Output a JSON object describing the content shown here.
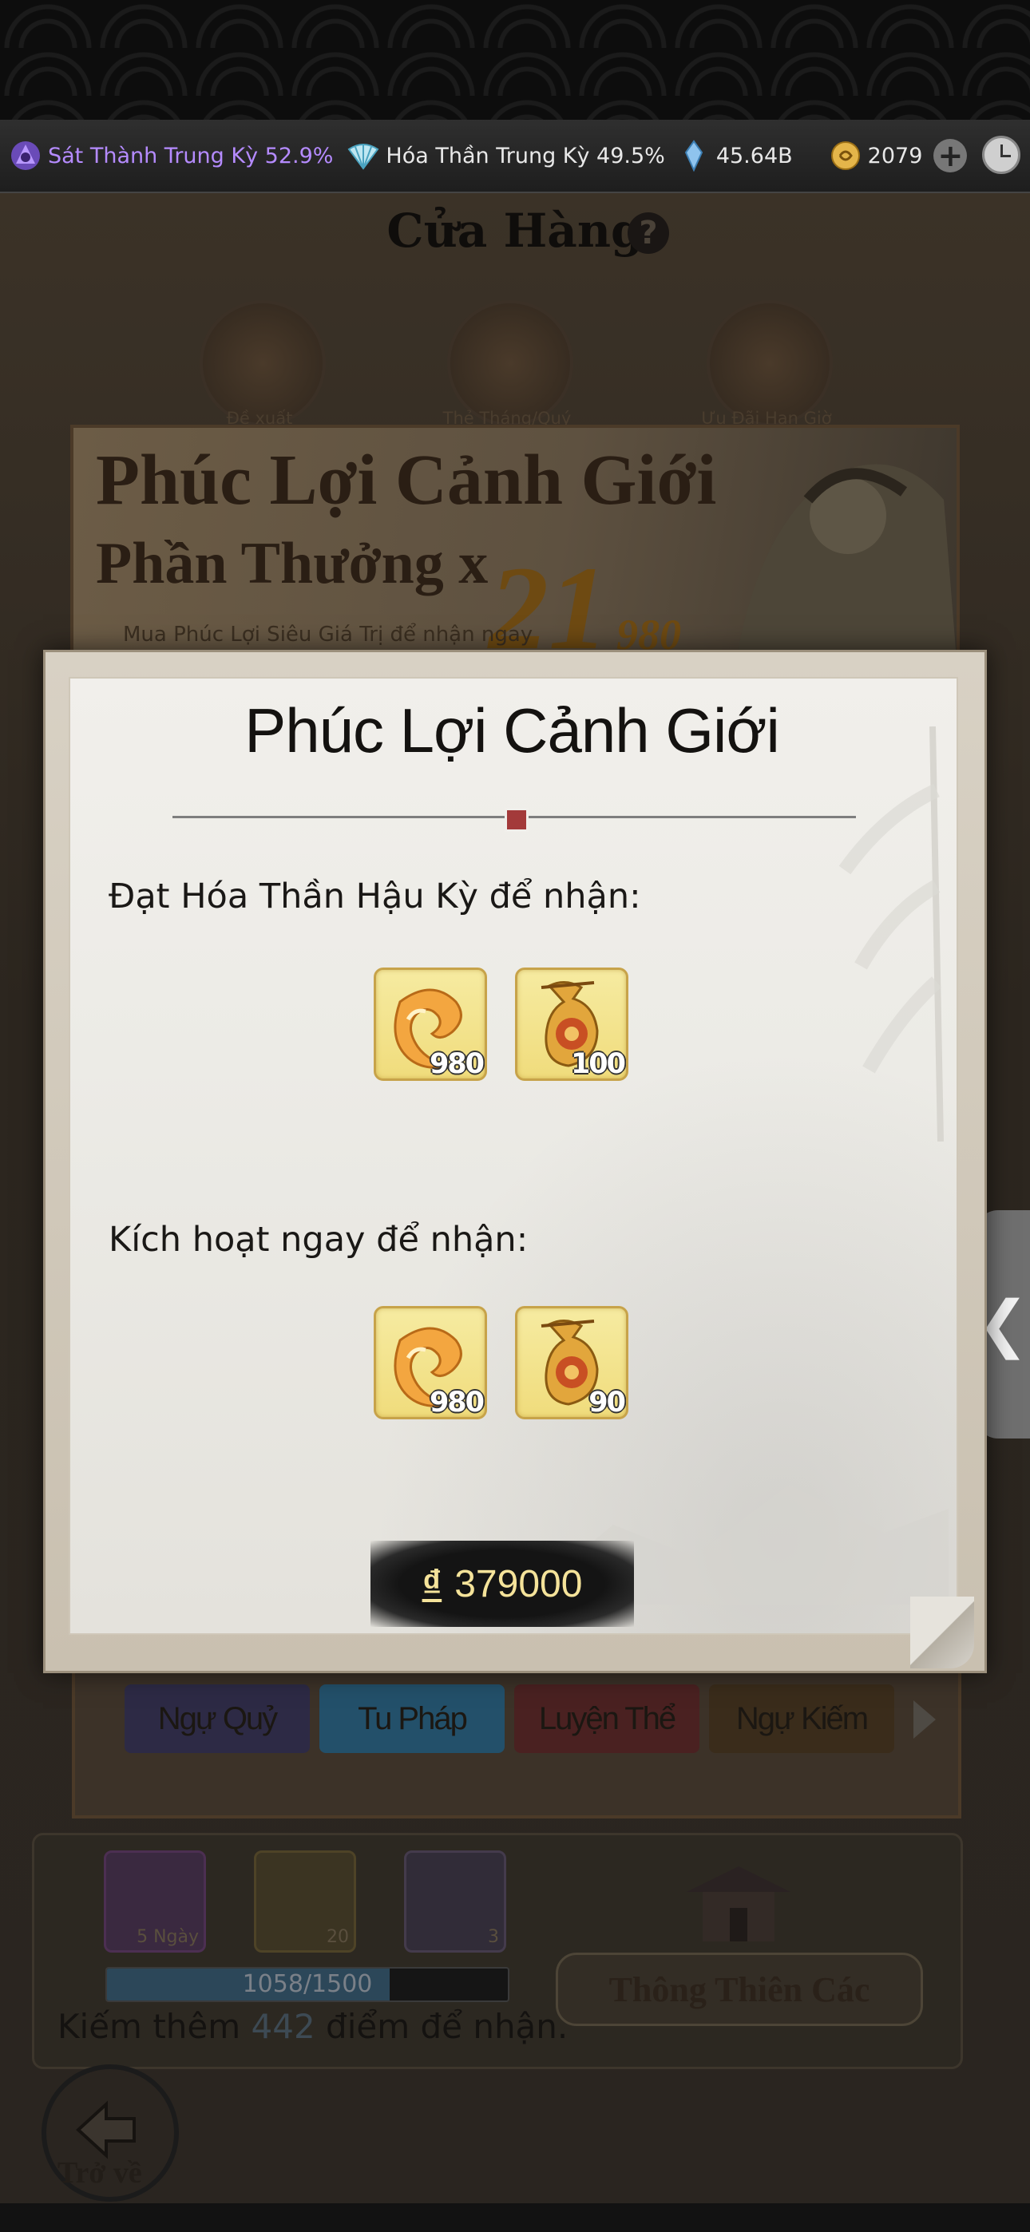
{
  "resources": {
    "realm1": "Sát Thành Trung Kỳ 52.9%",
    "realm2": "Hóa Thần Trung Kỳ 49.5%",
    "crystal": "45.64B",
    "coins": "2079",
    "plus": "+"
  },
  "shop": {
    "title": "Cửa Hàng",
    "help": "?",
    "tabs": [
      {
        "label": "Đề xuất"
      },
      {
        "label": "Thẻ Tháng/Quý"
      },
      {
        "label": "Ưu Đãi Hạn Giờ"
      }
    ],
    "banner": {
      "title": "Phúc Lợi Cảnh Giới",
      "reward_line": "Phần Thưởng x",
      "multiplier": "21",
      "subtitle": "Mua Phúc Lợi Siêu Giá Trị để nhận ngay",
      "amount": "980"
    },
    "categories": [
      "Ngự Quỷ",
      "Tu Pháp",
      "Luyện Thể",
      "Ngự Kiếm"
    ],
    "points_items": [
      {
        "count": "5 Ngày"
      },
      {
        "count": "20"
      },
      {
        "count": "3"
      }
    ],
    "progress": {
      "text": "1058/1500",
      "value": 0.7053
    },
    "points_prefix": "Kiếm thêm ",
    "points_number": "442",
    "points_suffix": " điểm để nhận.",
    "thong_thien": "Thông Thiên Các",
    "back": "Trở về"
  },
  "side_tab": "❮",
  "modal": {
    "title": "Phúc Lợi Cảnh Giới",
    "section1_label": "Đạt Hóa Thần Hậu Kỳ để nhận:",
    "section1_rewards": [
      {
        "icon": "horn-icon",
        "count": "980"
      },
      {
        "icon": "gourd-icon",
        "count": "100"
      }
    ],
    "section2_label": "Kích hoạt ngay để nhận:",
    "section2_rewards": [
      {
        "icon": "horn-icon",
        "count": "980"
      },
      {
        "icon": "gourd-icon",
        "count": "90"
      }
    ],
    "price_currency": "₫",
    "price": "379000"
  },
  "colors": {
    "reward_bg": "#f0dc7c",
    "price_text": "#f5e39a",
    "realm1_text": "#b58bff"
  }
}
